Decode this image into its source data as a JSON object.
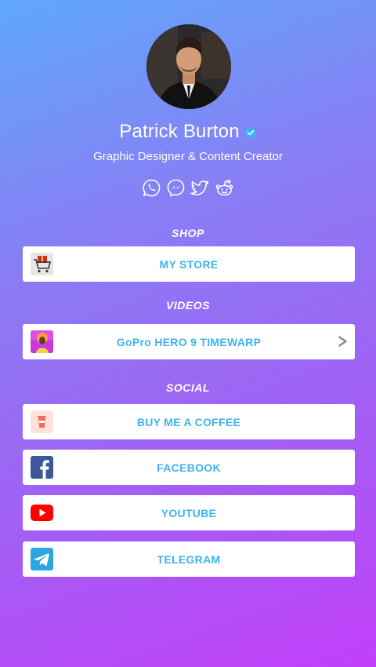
{
  "profile": {
    "name": "Patrick Burton",
    "bio": "Graphic Designer & Content Creator",
    "verified": true
  },
  "socials": [
    {
      "icon": "whatsapp-icon"
    },
    {
      "icon": "messenger-icon"
    },
    {
      "icon": "twitter-icon"
    },
    {
      "icon": "reddit-icon"
    }
  ],
  "sections": {
    "shop": {
      "title": "SHOP",
      "links": [
        {
          "label": "MY STORE",
          "icon": "shopping-cart-icon"
        }
      ]
    },
    "videos": {
      "title": "VIDEOS",
      "links": [
        {
          "label": "GoPro HERO 9 TIMEWARP",
          "icon": "video-thumbnail",
          "has_chevron": true
        }
      ]
    },
    "social": {
      "title": "SOCIAL",
      "links": [
        {
          "label": "BUY ME A COFFEE",
          "icon": "coffee-cup-icon"
        },
        {
          "label": "FACEBOOK",
          "icon": "facebook-icon"
        },
        {
          "label": "YOUTUBE",
          "icon": "youtube-icon"
        },
        {
          "label": "TELEGRAM",
          "icon": "telegram-icon"
        }
      ]
    }
  },
  "colors": {
    "gradient_start": "#5fa8fb",
    "gradient_end": "#c23ffa",
    "link_text": "#3fb3ec",
    "verified_badge": "#3fb3ec"
  }
}
